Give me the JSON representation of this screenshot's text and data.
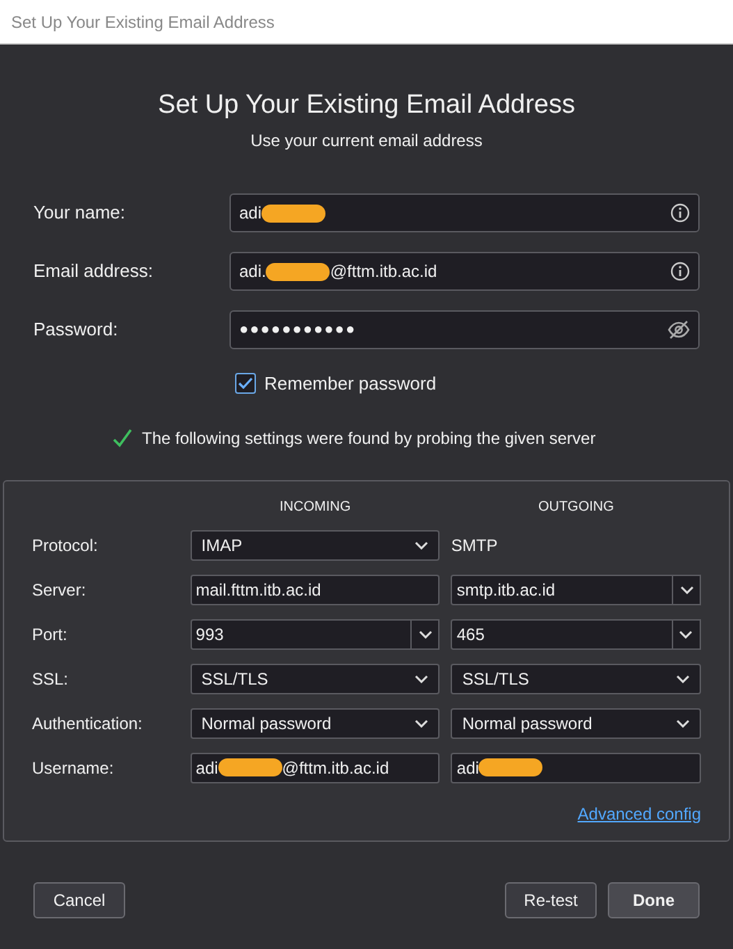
{
  "window": {
    "title": "Set Up Your Existing Email Address"
  },
  "heading": "Set Up Your Existing Email Address",
  "subtitle": "Use your current email address",
  "fields": [
    {
      "label": "Your name:",
      "kind": "text",
      "value": "adi",
      "redacted": true
    },
    {
      "label": "Email address:",
      "kind": "text",
      "value": "adi.",
      "redacted": true,
      "value_suffix": "@fttm.itb.ac.id"
    },
    {
      "label": "Password:",
      "kind": "password",
      "value": "●●●●●●●●●●●"
    }
  ],
  "remember": {
    "label": "Remember password",
    "checked": true
  },
  "status": {
    "text": "The following settings were found by probing the given server",
    "ok": true
  },
  "settings": {
    "columns": [
      "INCOMING",
      "OUTGOING"
    ],
    "rows": [
      {
        "label": "Protocol:",
        "incoming": {
          "kind": "select",
          "value": "IMAP"
        },
        "outgoing": {
          "kind": "text",
          "value": "SMTP"
        }
      },
      {
        "label": "Server:",
        "incoming": {
          "kind": "input",
          "value": "mail.fttm.itb.ac.id"
        },
        "outgoing": {
          "kind": "combo",
          "value": "smtp.itb.ac.id"
        }
      },
      {
        "label": "Port:",
        "incoming": {
          "kind": "combo",
          "value": "993"
        },
        "outgoing": {
          "kind": "combo",
          "value": "465"
        }
      },
      {
        "label": "SSL:",
        "incoming": {
          "kind": "select",
          "value": "SSL/TLS"
        },
        "outgoing": {
          "kind": "select",
          "value": "SSL/TLS"
        }
      },
      {
        "label": "Authentication:",
        "incoming": {
          "kind": "select",
          "value": "Normal password"
        },
        "outgoing": {
          "kind": "select",
          "value": "Normal password"
        }
      },
      {
        "label": "Username:",
        "incoming": {
          "kind": "input",
          "value": "adi",
          "redacted": true,
          "value_suffix": "@fttm.itb.ac.id"
        },
        "outgoing": {
          "kind": "input",
          "value": "adi",
          "redacted": true
        }
      }
    ],
    "advanced_link": "Advanced config"
  },
  "buttons": [
    {
      "label": "Cancel",
      "kind": "secondary"
    },
    {
      "label": "Re-test",
      "kind": "secondary"
    },
    {
      "label": "Done",
      "kind": "primary"
    }
  ]
}
